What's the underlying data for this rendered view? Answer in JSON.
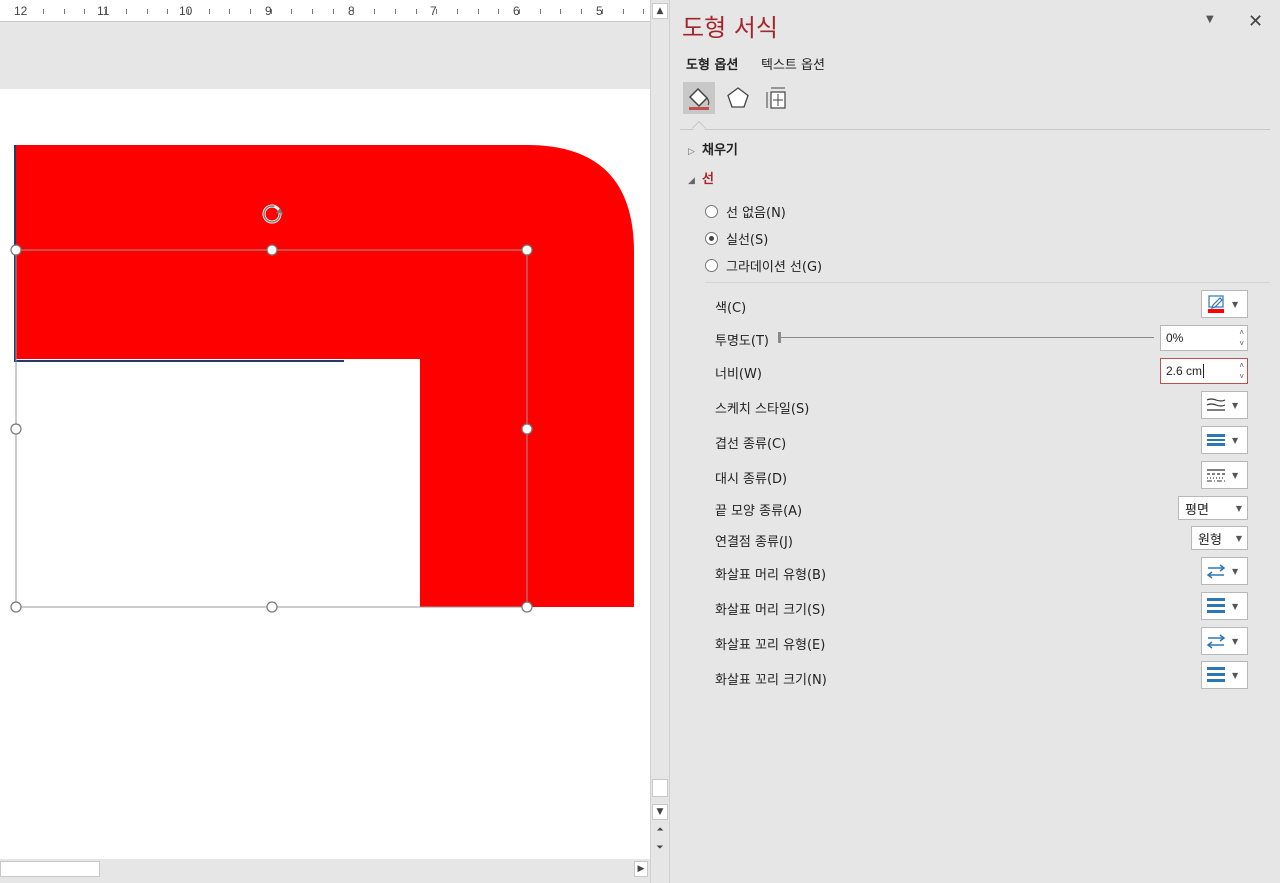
{
  "ruler": {
    "numbers": [
      "12",
      "11",
      "10",
      "9",
      "8",
      "7",
      "6",
      "5"
    ]
  },
  "panel": {
    "title": "도형 서식",
    "tabs": [
      {
        "label": "도형 옵션",
        "active": true
      },
      {
        "label": "텍스트 옵션",
        "active": false
      }
    ],
    "icon_tabs": [
      "fill-line-icon",
      "effects-pentagon-icon",
      "size-properties-icon"
    ],
    "fill_section": {
      "label": "채우기",
      "expanded": false
    },
    "line_section": {
      "label": "선",
      "expanded": true,
      "radios": [
        {
          "label": "선 없음(N)",
          "checked": false
        },
        {
          "label": "실선(S)",
          "checked": true
        },
        {
          "label": "그라데이션 선(G)",
          "checked": false
        }
      ],
      "color": {
        "label": "색(C)",
        "swatch": "#ff0000"
      },
      "transparency": {
        "label": "투명도(T)",
        "value": "0%",
        "level": 0
      },
      "width": {
        "label": "너비(W)",
        "value": "2.6 cm"
      },
      "sketch_style": {
        "label": "스케치 스타일(S)"
      },
      "compound_type": {
        "label": "겹선 종류(C)"
      },
      "dash_type": {
        "label": "대시 종류(D)"
      },
      "cap_type": {
        "label": "끝 모양 종류(A)",
        "value": "평면"
      },
      "join_type": {
        "label": "연결점 종류(J)",
        "value": "원형"
      },
      "begin_arrow_type": {
        "label": "화살표 머리 유형(B)"
      },
      "begin_arrow_size": {
        "label": "화살표 머리 크기(S)"
      },
      "end_arrow_type": {
        "label": "화살표 꼬리 유형(E)"
      },
      "end_arrow_size": {
        "label": "화살표 꼬리 크기(N)"
      }
    }
  },
  "colors": {
    "shape_fill": "#ff0000",
    "accent": "#a4262c",
    "icon_blue": "#2e75b6"
  }
}
